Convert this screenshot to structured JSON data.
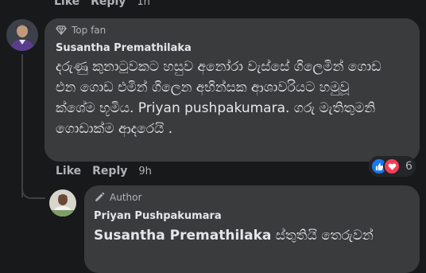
{
  "top_actions": {
    "like": "Like",
    "reply": "Reply",
    "time": "1h"
  },
  "comment1": {
    "badge": "Top fan",
    "author": "Susantha Premathilaka",
    "text": "දරුණු කුනාටුවකට හසුව අනෝරා වැස්සේ ගිලෙමින් ගොඩ එන ගොඩ එමින් ගිලෙන අභින්සක ආශාවරියට හමුවූ ක්ශේම භූමිය. Priyan pushpakumara. ගරු මැතිතුමනි ගොඩාක්ම ආදරෙයි .",
    "actions": {
      "like": "Like",
      "reply": "Reply",
      "time": "9h"
    },
    "reactions": {
      "count": "6",
      "icons": [
        "like-icon",
        "love-icon"
      ]
    }
  },
  "reply1": {
    "badge": "Author",
    "author": "Priyan Pushpakumara",
    "mention": "Susantha Premathilaka",
    "text": " ස්තුතියි තෙරුවන්"
  },
  "colors": {
    "background": "#18191a",
    "bubble": "#3a3b3c",
    "like_blue": "#1877f2",
    "love_red": "#f33e58"
  }
}
